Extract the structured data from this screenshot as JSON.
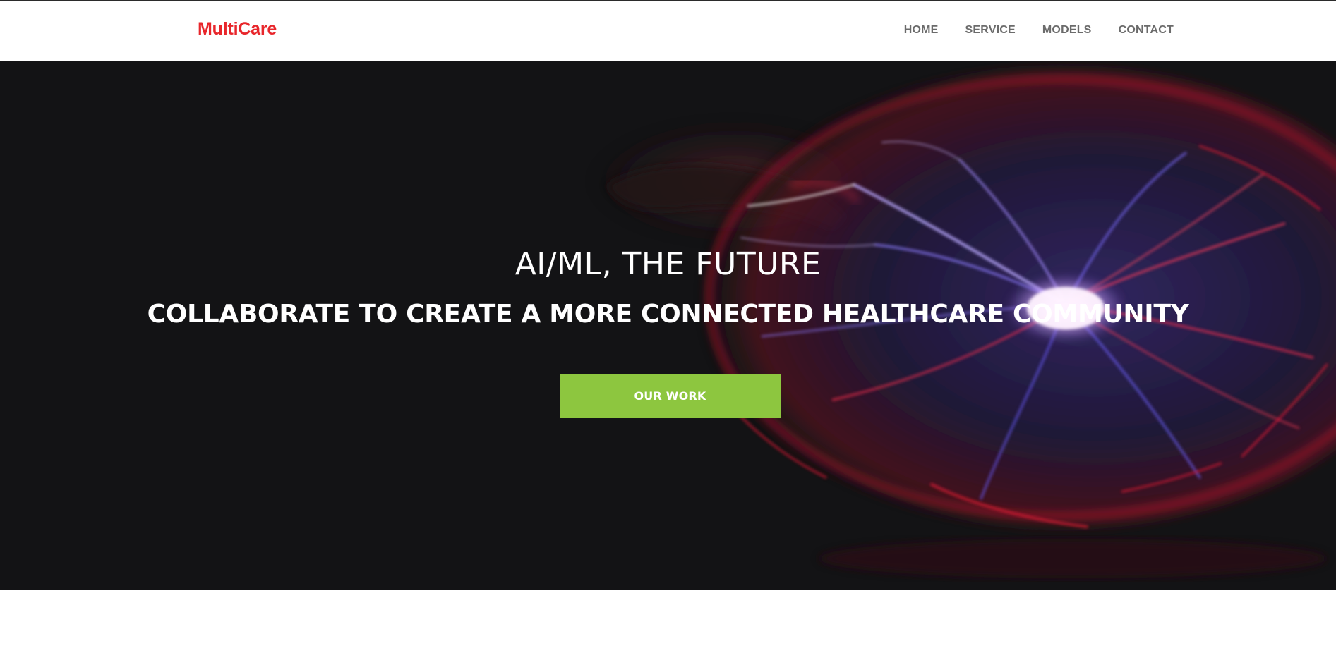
{
  "header": {
    "logo_text": "MultiCare",
    "nav": [
      {
        "label": "HOME"
      },
      {
        "label": "SERVICE"
      },
      {
        "label": "MODELS"
      },
      {
        "label": "CONTACT"
      }
    ]
  },
  "hero": {
    "title": "AI/ML, THE FUTURE",
    "subtitle": "COLLABORATE TO CREATE A MORE CONNECTED HEALTHCARE COMMUNITY",
    "button_label": "OUR WORK",
    "background_image": "plasma-ball-with-hand"
  },
  "colors": {
    "brand": "#e8262b",
    "accent": "#8dc63f",
    "nav_text": "#6b6b6b",
    "hero_bg": "#131315"
  }
}
